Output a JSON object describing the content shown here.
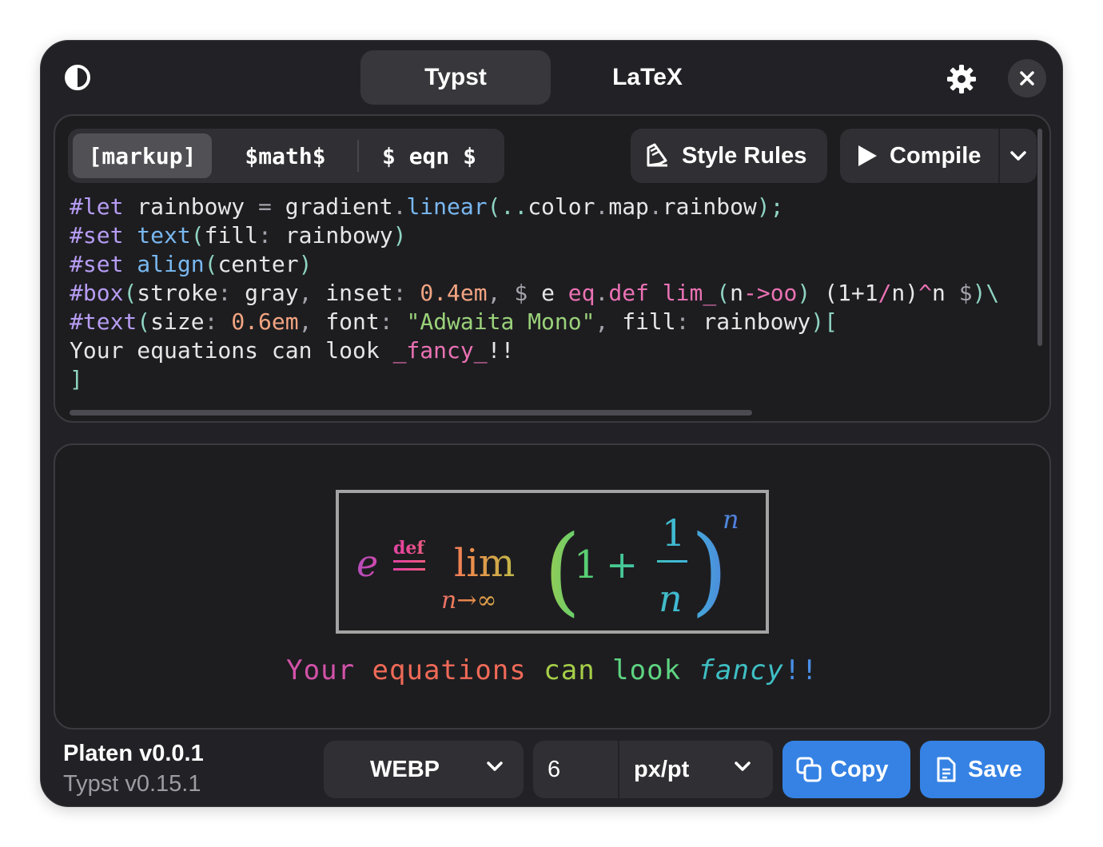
{
  "header": {
    "theme_icon": "contrast-icon",
    "tabs": [
      {
        "label": "Typst",
        "active": true
      },
      {
        "label": "LaTeX",
        "active": false
      }
    ],
    "settings_icon": "gear-icon",
    "close_icon": "close-icon"
  },
  "editor": {
    "modes": [
      "[markup]",
      "$math$",
      "$ eqn $"
    ],
    "selected_mode": "[markup]",
    "style_rules_label": "Style Rules",
    "compile_label": "Compile",
    "code_lines": [
      "#let rainbowy = gradient.linear(..color.map.rainbow);",
      "#set text(fill: rainbowy)",
      "#set align(center)",
      "#box(stroke: gray, inset: 0.4em, $ e eq.def lim_(n->oo) (1+1/n)^n $)\\",
      "#text(size: 0.6em, font: \"Adwaita Mono\", fill: rainbowy)[",
      "Your equations can look _fancy_!!",
      "]"
    ]
  },
  "preview": {
    "formula": {
      "e": "e",
      "def": "def",
      "lim": "lim",
      "sub": "n→∞",
      "one": "1",
      "plus": "+",
      "num": "1",
      "den": "n",
      "exp": "n"
    },
    "fancy_text": {
      "words": [
        "Your",
        "equations",
        "can",
        "look"
      ],
      "fancy": "fancy",
      "bang": "!!"
    }
  },
  "footer": {
    "app_name": "Platen v0.0.1",
    "typst_version": "Typst v0.15.1",
    "format": "WEBP",
    "scale": "6",
    "unit": "px/pt",
    "copy_label": "Copy",
    "save_label": "Save"
  },
  "colors": {
    "window_bg": "#222226",
    "panel_bg": "#1d1d20",
    "accent_blue": "#3582e4",
    "button_bg": "#303034"
  }
}
